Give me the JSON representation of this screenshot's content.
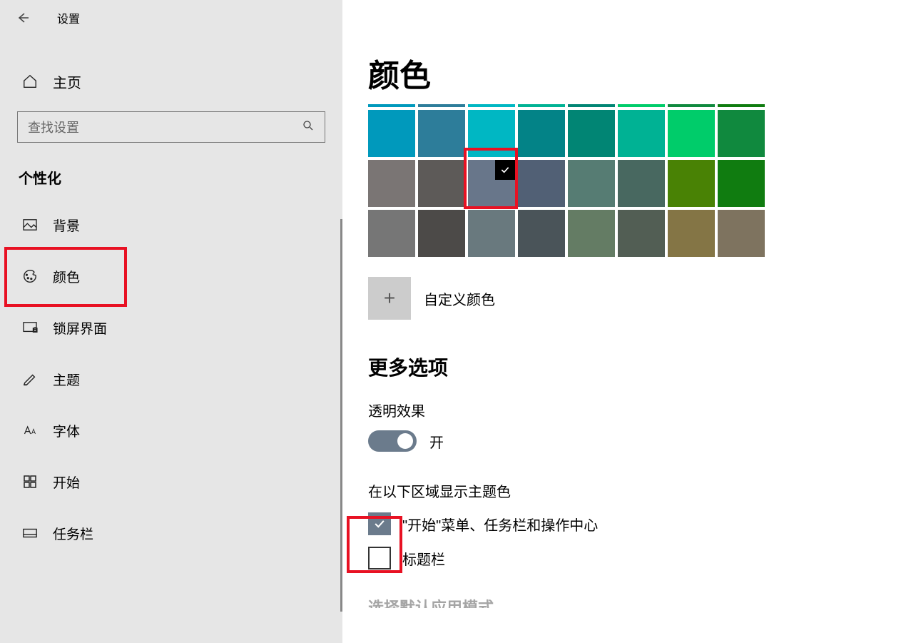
{
  "header": {
    "title": "设置"
  },
  "sidebar": {
    "home": "主页",
    "search_placeholder": "查找设置",
    "section": "个性化",
    "items": [
      {
        "icon": "picture-icon",
        "label": "背景"
      },
      {
        "icon": "palette-icon",
        "label": "颜色"
      },
      {
        "icon": "lock-screen-icon",
        "label": "锁屏界面"
      },
      {
        "icon": "theme-icon",
        "label": "主题"
      },
      {
        "icon": "font-icon",
        "label": "字体"
      },
      {
        "icon": "start-icon",
        "label": "开始"
      },
      {
        "icon": "taskbar-icon",
        "label": "任务栏"
      }
    ]
  },
  "main": {
    "title": "颜色",
    "colors_row0": [
      "#0099bc",
      "#2d7d9a",
      "#00b7c3",
      "#00b294",
      "#018574",
      "#00cc6a",
      "#10893e",
      "#107c10"
    ],
    "colors_row1": [
      "#0099bc",
      "#2d7d9a",
      "#00b7c3",
      "#038387",
      "#018574",
      "#00b294",
      "#00cc6a",
      "#10893e"
    ],
    "colors_row2": [
      "#7a7574",
      "#5d5a58",
      "#68768a",
      "#516075",
      "#567c73",
      "#486860",
      "#498205",
      "#107c10"
    ],
    "colors_row3": [
      "#767676",
      "#4c4a48",
      "#69797e",
      "#4a5459",
      "#647c64",
      "#525e54",
      "#847545",
      "#7e735f"
    ],
    "selected_index": {
      "row": 2,
      "col": 2
    },
    "custom_color": "自定义颜色",
    "more_options": "更多选项",
    "transparency_label": "透明效果",
    "toggle_state": "开",
    "accent_section": "在以下区域显示主题色",
    "checkbox1_label": "\"开始\"菜单、任务栏和操作中心",
    "checkbox1_checked": true,
    "checkbox2_label": "标题栏",
    "checkbox2_checked": false,
    "partial": "选择默认应用模式"
  },
  "highlights": {
    "sidebar_color_item": true,
    "selected_swatch": true,
    "checkbox1": true
  }
}
